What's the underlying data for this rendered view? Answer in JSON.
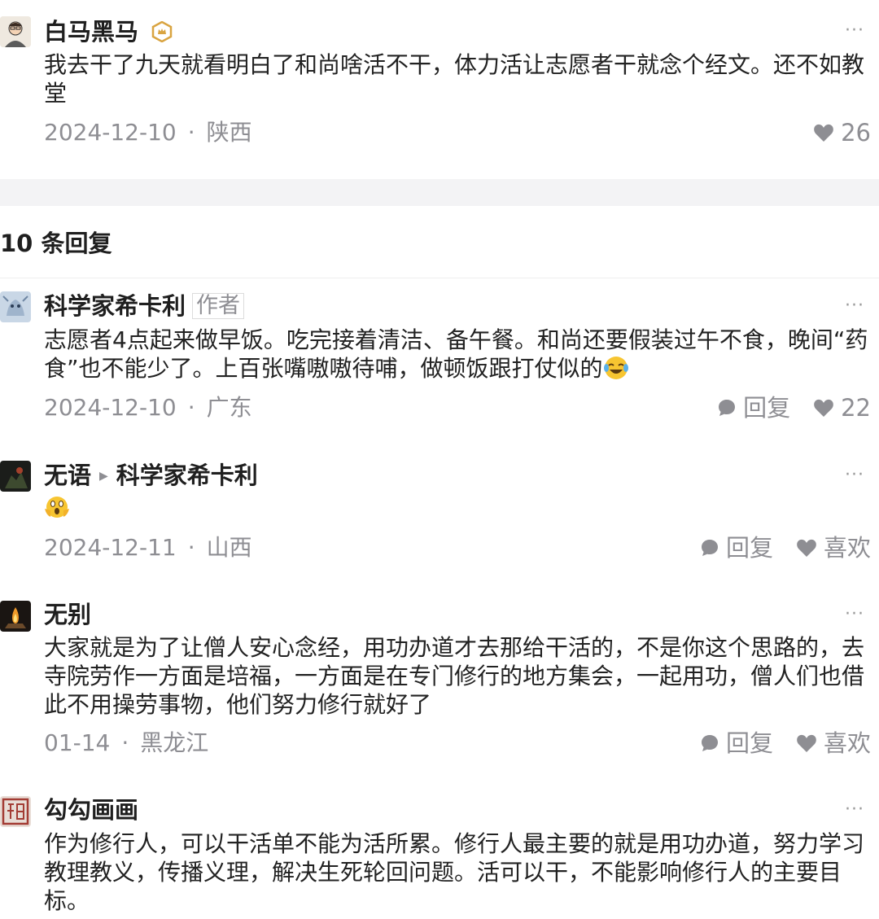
{
  "main_post": {
    "author": "白马黑马",
    "text": "我去干了九天就看明白了和尚啥活不干，体力活让志愿者干就念个经文。还不如教堂",
    "date": "2024-12-10",
    "location": "陕西",
    "likes": "26",
    "more": "···"
  },
  "replies_header": "10 条回复",
  "comments": [
    {
      "author": "科学家希卡利",
      "author_tag": "作者",
      "text": "志愿者4点起来做早饭。吃完接着清洁、备午餐。和尚还要假装过午不食，晚间“药食”也不能少了。上百张嘴嗷嗷待哺，做顿饭跟打仗似的",
      "date": "2024-12-10",
      "location": "广东",
      "reply_label": "回复",
      "like_label": "22",
      "more": "···"
    },
    {
      "author": "无语",
      "reply_to": "科学家希卡利",
      "date": "2024-12-11",
      "location": "山西",
      "reply_label": "回复",
      "like_label": "喜欢",
      "more": "···"
    },
    {
      "author": "无别",
      "text": "大家就是为了让僧人安心念经，用功办道才去那给干活的，不是你这个思路的，去寺院劳作一方面是培福，一方面是在专门修行的地方集会，一起用功，僧人们也借此不用操劳事物，他们努力修行就好了",
      "date": "01-14",
      "location": "黑龙江",
      "reply_label": "回复",
      "like_label": "喜欢",
      "more": "···"
    },
    {
      "author": "勾勾画画",
      "text": "作为修行人，可以干活单不能为活所累。修行人最主要的就是用功办道，努力学习教理教义，传播义理，解决生死轮回问题。活可以干，不能影响修行人的主要目标。",
      "more": "···"
    }
  ],
  "colors": {
    "meta_gray": "#8e8e93",
    "band_bg": "#f3f3f5",
    "vip_badge": "#d9a441"
  }
}
